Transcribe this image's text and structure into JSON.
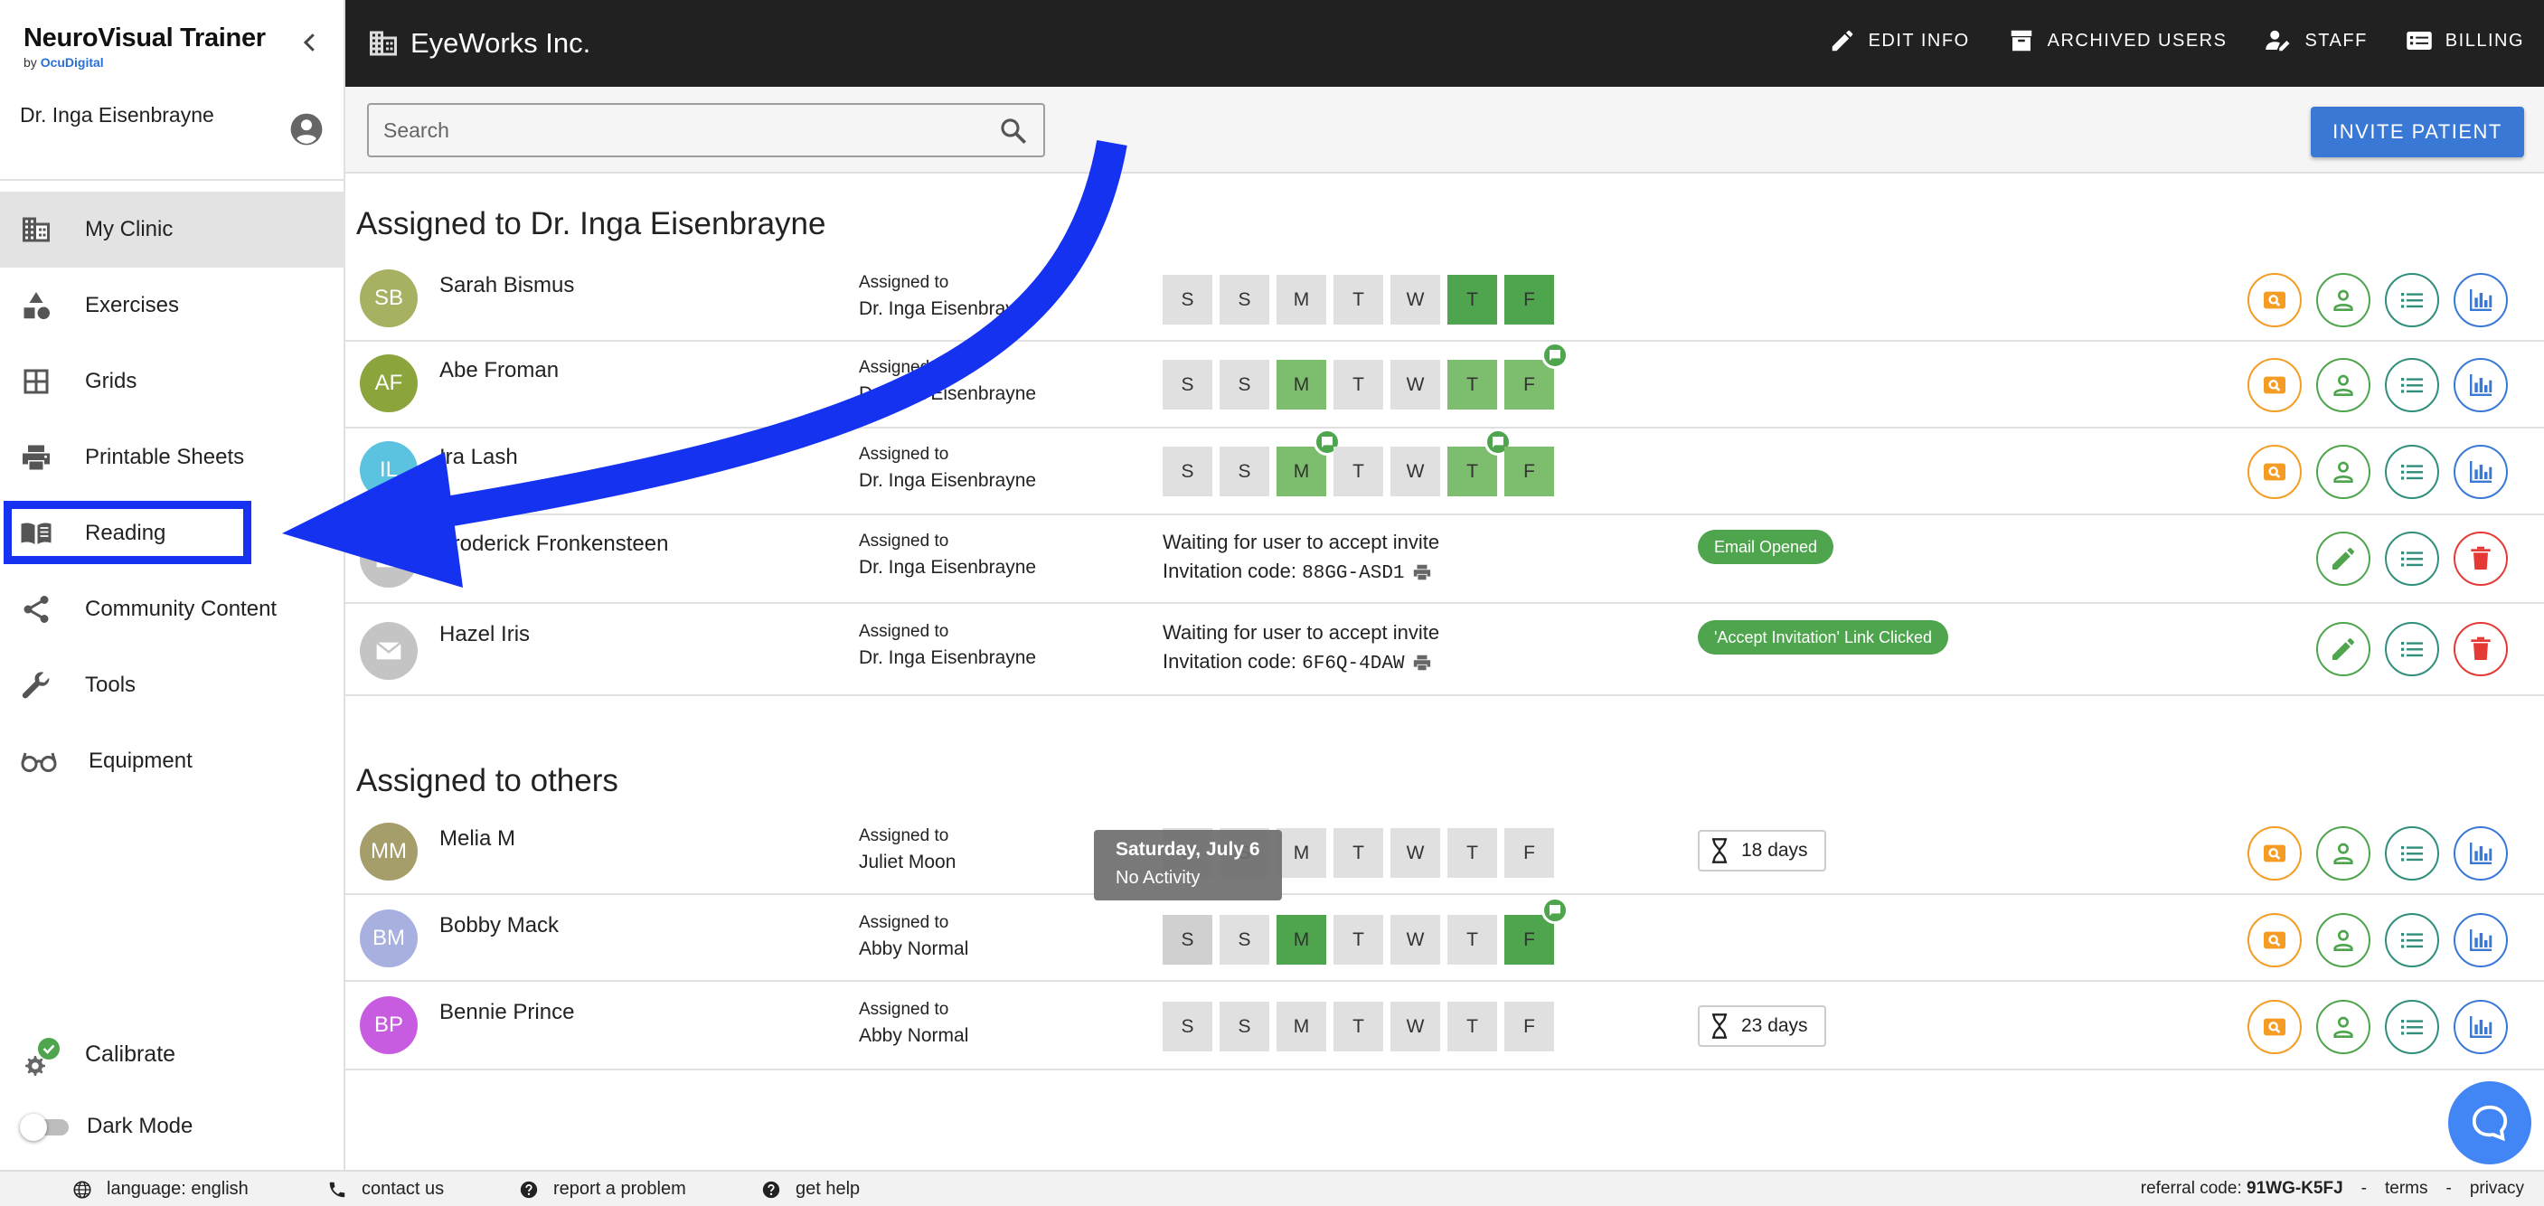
{
  "sidebar": {
    "brand_title": "NeuroVisual Trainer",
    "brand_by": "by",
    "brand_company": "OcuDigital",
    "user_name": "Dr. Inga Eisenbrayne",
    "items": [
      {
        "label": "My Clinic",
        "icon": "clinic-building-icon",
        "active": true
      },
      {
        "label": "Exercises",
        "icon": "shapes-icon"
      },
      {
        "label": "Grids",
        "icon": "grid-icon"
      },
      {
        "label": "Printable Sheets",
        "icon": "printer-icon"
      },
      {
        "label": "Reading",
        "icon": "open-book-icon",
        "highlighted": true
      },
      {
        "label": "Community Content",
        "icon": "share-icon"
      },
      {
        "label": "Tools",
        "icon": "wrench-icon"
      },
      {
        "label": "Equipment",
        "icon": "glasses-icon"
      }
    ],
    "calibrate_label": "Calibrate",
    "dark_mode_label": "Dark Mode"
  },
  "header": {
    "org_name": "EyeWorks Inc.",
    "actions": {
      "edit_info": "EDIT INFO",
      "archived_users": "ARCHIVED USERS",
      "staff": "STAFF",
      "billing": "BILLING"
    }
  },
  "search": {
    "placeholder": "Search"
  },
  "invite_button": "INVITE PATIENT",
  "sections": {
    "mine_title": "Assigned to Dr. Inga Eisenbrayne",
    "others_title": "Assigned to others"
  },
  "patients": {
    "mine": [
      {
        "initials": "SB",
        "name": "Sarah Bismus",
        "assigned_label": "Assigned to",
        "assigned_to": "Dr. Inga Eisenbrayne"
      },
      {
        "initials": "AF",
        "name": "Abe Froman",
        "assigned_label": "Assigned to",
        "assigned_to": "Dr. Inga Eisenbrayne"
      },
      {
        "initials": "IL",
        "name": "Ira Lash",
        "assigned_label": "Assigned to",
        "assigned_to": "Dr. Inga Eisenbrayne"
      },
      {
        "name": "Froderick Fronkensteen",
        "assigned_label": "Assigned to",
        "assigned_to": "Dr. Inga Eisenbrayne",
        "waiting": "Waiting for user to accept invite",
        "code_label": "Invitation code:",
        "code": "88GG-ASD1",
        "badge": "Email Opened"
      },
      {
        "name": "Hazel Iris",
        "assigned_label": "Assigned to",
        "assigned_to": "Dr. Inga Eisenbrayne",
        "waiting": "Waiting for user to accept invite",
        "code_label": "Invitation code:",
        "code": "6F6Q-4DAW",
        "badge": "'Accept Invitation' Link Clicked"
      }
    ],
    "others": [
      {
        "initials": "MM",
        "name": "Melia M",
        "assigned_label": "Assigned to",
        "assigned_to": "Juliet Moon",
        "duration": "18 days"
      },
      {
        "initials": "BM",
        "name": "Bobby Mack",
        "assigned_label": "Assigned to",
        "assigned_to": "Abby Normal"
      },
      {
        "initials": "BP",
        "name": "Bennie Prince",
        "assigned_label": "Assigned to",
        "assigned_to": "Abby Normal",
        "duration": "23 days"
      }
    ]
  },
  "days": {
    "s1": "S",
    "s2": "S",
    "m": "M",
    "t1": "T",
    "w": "W",
    "t2": "T",
    "f": "F"
  },
  "tooltip": {
    "date": "Saturday, July 6",
    "status": "No Activity"
  },
  "footer": {
    "language": "language: english",
    "contact": "contact us",
    "report": "report a problem",
    "help": "get help",
    "referral_label": "referral code:",
    "referral_code": "91WG-K5FJ",
    "sep": "-",
    "terms": "terms",
    "privacy": "privacy"
  },
  "colors": {
    "accent_blue": "#3a78d6",
    "activity_green": "#4ea54d",
    "activity_light_green": "#7dbd6e",
    "header_dark": "#212121",
    "annotation_blue": "#1432f0"
  }
}
